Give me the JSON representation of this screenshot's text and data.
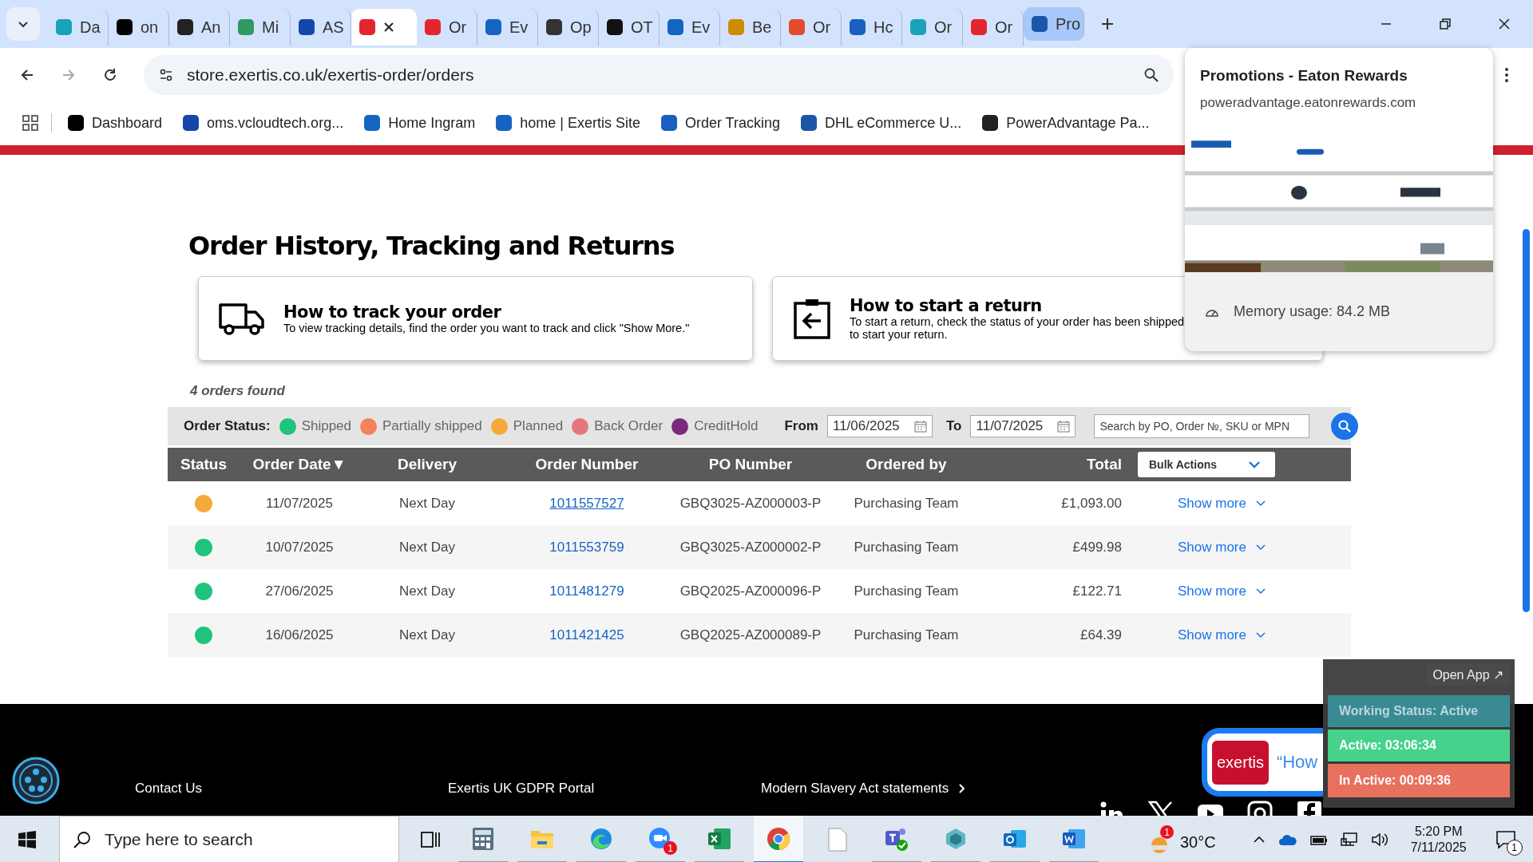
{
  "browser": {
    "tabs": [
      {
        "label": "Da",
        "selected": false
      },
      {
        "label": "on",
        "selected": false
      },
      {
        "label": "An",
        "selected": false
      },
      {
        "label": "Mi",
        "selected": false
      },
      {
        "label": "AS",
        "selected": false
      },
      {
        "selected": true
      },
      {
        "label": "Or",
        "selected": false
      },
      {
        "label": "Ev",
        "selected": false
      },
      {
        "label": "Op",
        "selected": false
      },
      {
        "label": "OT",
        "selected": false
      },
      {
        "label": "Ev",
        "selected": false
      },
      {
        "label": "Be",
        "selected": false
      },
      {
        "label": "Or",
        "selected": false
      },
      {
        "label": "Hc",
        "selected": false
      },
      {
        "label": "Or",
        "selected": false
      },
      {
        "label": "Or",
        "selected": false
      },
      {
        "label": "Pro",
        "selected": false,
        "hovered": true
      }
    ],
    "url": "store.exertis.co.uk/exertis-order/orders",
    "bookmarks": [
      "Dashboard",
      "oms.vcloudtech.org...",
      "Home Ingram",
      "home | Exertis Site",
      "Order Tracking",
      "DHL eCommerce U...",
      "PowerAdvantage Pa..."
    ],
    "tab_preview": {
      "title": "Promotions - Eaton Rewards",
      "domain": "poweradvantage.eatonrewards.com",
      "memory": "Memory usage: 84.2 MB"
    }
  },
  "page": {
    "title": "Order History, Tracking and Returns",
    "cards": [
      {
        "kind": "track",
        "heading": "How to track your order",
        "lines": [
          "To view tracking details, find the order you want to track and click \"Show More.\""
        ]
      },
      {
        "kind": "return",
        "heading": "How to start a return",
        "lines": [
          "To start a return, check the status of your order has been shipped",
          "to start your return."
        ]
      }
    ],
    "orders_found": "4 orders found",
    "filter": {
      "label": "Order Status:",
      "legend": [
        {
          "label": "Shipped",
          "color": "#1ec47a"
        },
        {
          "label": "Partially shipped",
          "color": "#f4825c"
        },
        {
          "label": "Planned",
          "color": "#f6a93b"
        },
        {
          "label": "Back Order",
          "color": "#e5767a"
        },
        {
          "label": "CreditHold",
          "color": "#7b2a7e"
        }
      ],
      "from_label": "From",
      "from": "11/06/2025",
      "to_label": "To",
      "to": "11/07/2025",
      "search_placeholder": "Search by PO, Order №, SKU or MPN"
    },
    "table": {
      "columns": [
        "Status",
        "Order Date▼",
        "Delivery",
        "Order Number",
        "PO Number",
        "Ordered by",
        "Total"
      ],
      "bulk_actions": "Bulk Actions",
      "rows": [
        {
          "color": "#f6a93b",
          "date": "11/07/2025",
          "delivery": "Next Day",
          "order": "1011557527",
          "hovered": true,
          "po": "GBQ3025-AZ000003-P",
          "by": "Purchasing Team",
          "total": "£1,093.00",
          "action": "Show more"
        },
        {
          "color": "#1ec47a",
          "date": "10/07/2025",
          "delivery": "Next Day",
          "order": "1011553759",
          "hovered": false,
          "po": "GBQ3025-AZ000002-P",
          "by": "Purchasing Team",
          "total": "£499.98",
          "action": "Show more"
        },
        {
          "color": "#1ec47a",
          "date": "27/06/2025",
          "delivery": "Next Day",
          "order": "1011481279",
          "hovered": false,
          "po": "GBQ2025-AZ000096-P",
          "by": "Purchasing Team",
          "total": "£122.71",
          "action": "Show more"
        },
        {
          "color": "#1ec47a",
          "date": "16/06/2025",
          "delivery": "Next Day",
          "order": "1011421425",
          "hovered": false,
          "po": "GBQ2025-AZ000089-P",
          "by": "Purchasing Team",
          "total": "£64.39",
          "action": "Show more"
        }
      ]
    },
    "footer": {
      "links": [
        "Contact Us",
        "Exertis UK GDPR Portal",
        "Modern Slavery Act statements"
      ]
    },
    "chat": {
      "logo": "exertis",
      "text": "“How"
    }
  },
  "tracker": {
    "open": "Open App ↗",
    "status": "Working Status: Active",
    "active": "Active: 03:06:34",
    "inactive": "In Active: 00:09:36"
  },
  "taskbar": {
    "search_placeholder": "Type here to search",
    "zoom_badge": "1",
    "weather_badge": "1",
    "temp": "30°C",
    "time": "5:20 PM",
    "date": "7/11/2025",
    "notifications": "1"
  }
}
